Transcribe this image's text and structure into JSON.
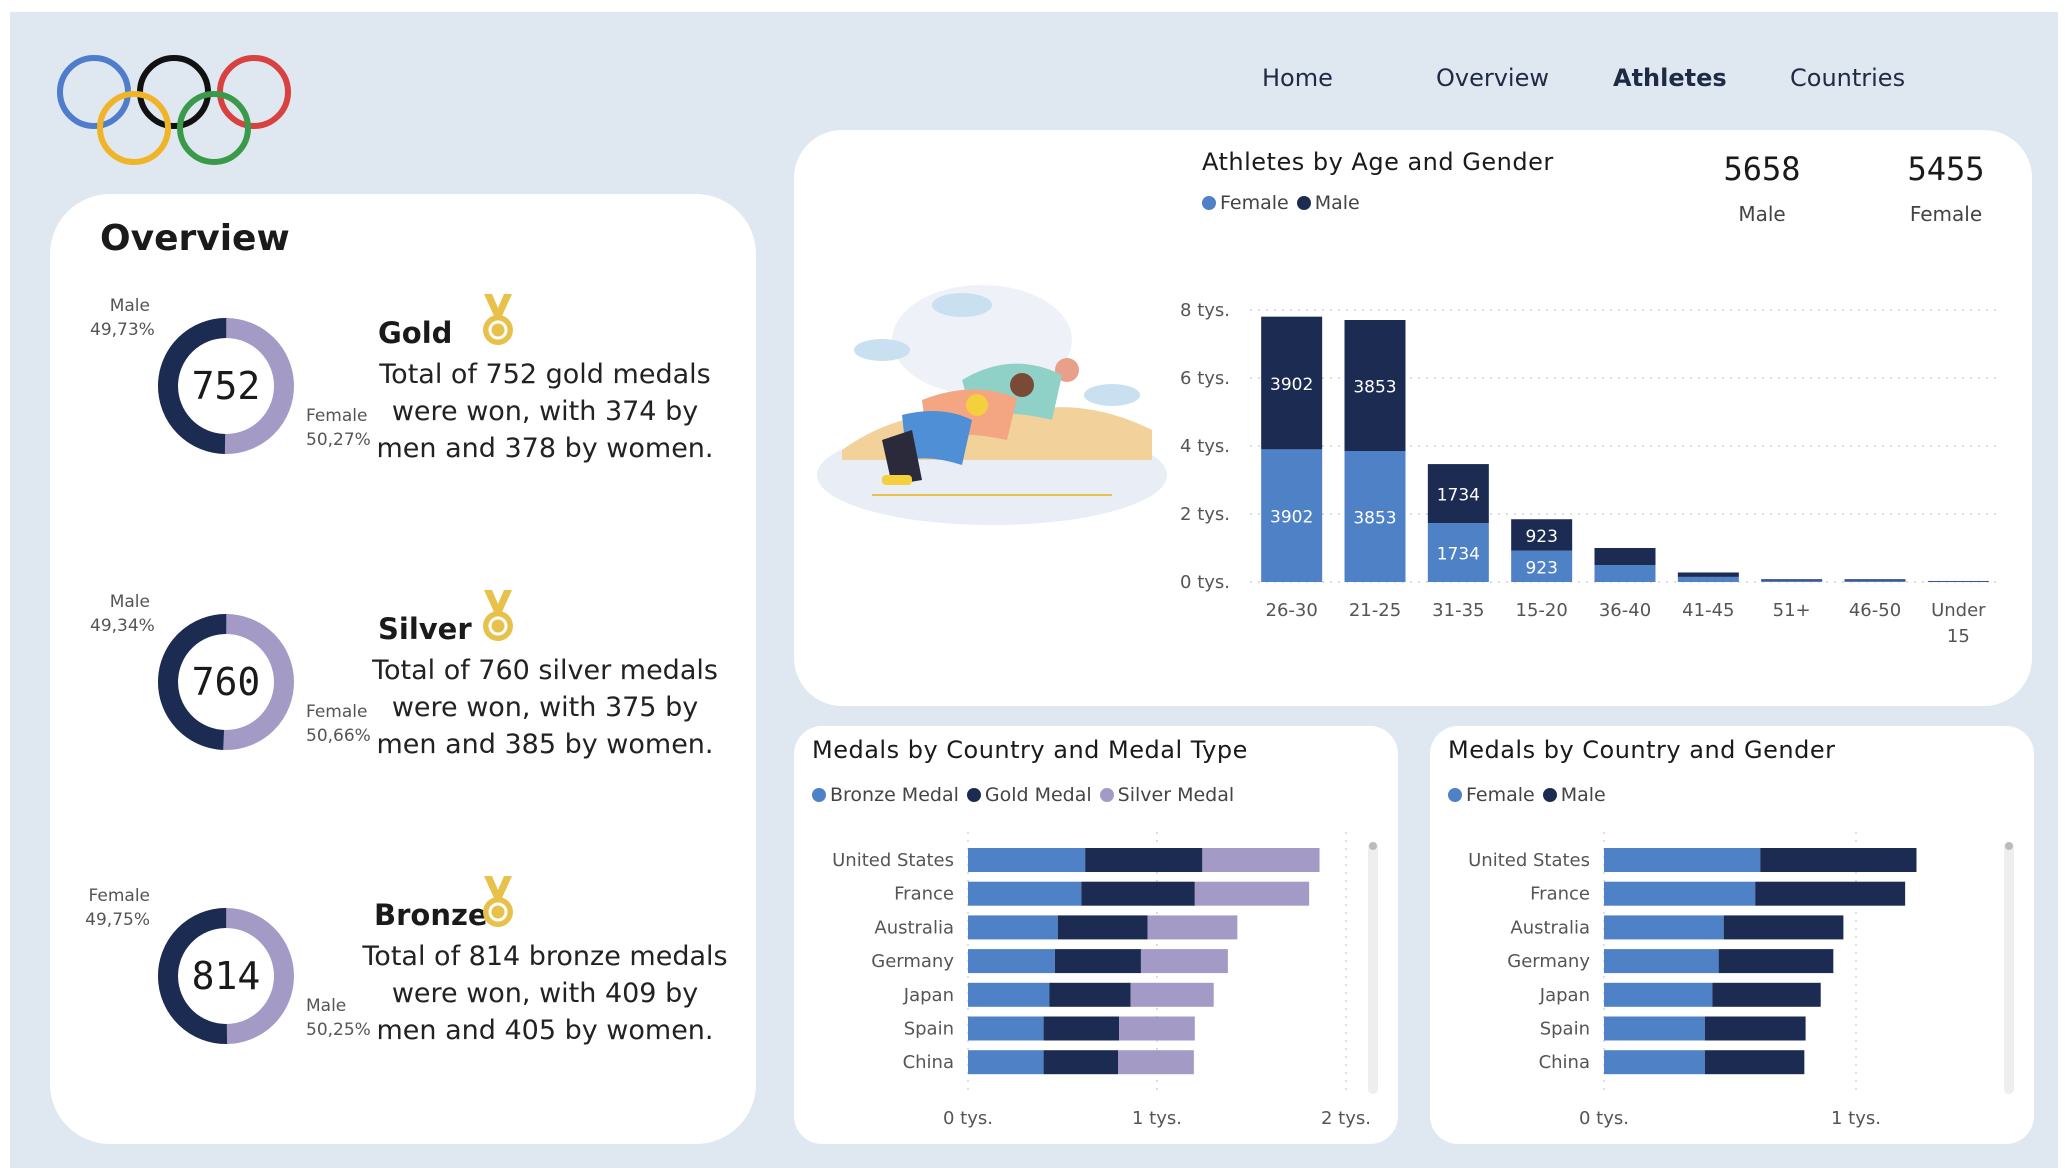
{
  "nav": {
    "items": [
      "Home",
      "Overview",
      "Athletes",
      "Countries"
    ],
    "active": "Athletes"
  },
  "overview": {
    "title": "Overview",
    "medals": [
      {
        "name": "Gold",
        "total": "752",
        "text": "Total of 752 gold medals were won, with 374 by men and 378 by women.",
        "label_top": "Male",
        "pct_top": "49,73%",
        "label_bottom": "Female",
        "pct_bottom": "50,27%",
        "male_share": 0.4973
      },
      {
        "name": "Silver",
        "total": "760",
        "text": "Total of 760 silver medals were won, with 375 by men and 385 by women.",
        "label_top": "Male",
        "pct_top": "49,34%",
        "label_bottom": "Female",
        "pct_bottom": "50,66%",
        "male_share": 0.4934
      },
      {
        "name": "Bronze",
        "total": "814",
        "text": "Total of 814 bronze medals were won, with 409 by men and 405 by women.",
        "label_top": "Female",
        "pct_top": "49,75%",
        "label_bottom": "Male",
        "pct_bottom": "50,25%",
        "male_share": 0.5025
      }
    ]
  },
  "athletes": {
    "title": "Athletes by Age and Gender",
    "legend": [
      "Female",
      "Male"
    ],
    "kpis": [
      {
        "value": "5658",
        "label": "Male"
      },
      {
        "value": "5455",
        "label": "Female"
      }
    ]
  },
  "medals_type": {
    "title": "Medals by Country and Medal Type",
    "legend": [
      "Bronze Medal",
      "Gold Medal",
      "Silver Medal"
    ]
  },
  "medals_gender": {
    "title": "Medals by Country and Gender",
    "legend": [
      "Female",
      "Male"
    ]
  },
  "colors": {
    "female": "#4f81c7",
    "male": "#1b2b52",
    "silver": "#a49ac6",
    "gold_icon": "#e8c14a",
    "grid": "#d0d4dc"
  },
  "chart_data": [
    {
      "type": "bar",
      "title": "Athletes by Age and Gender",
      "categories": [
        "26-30",
        "21-25",
        "31-35",
        "15-20",
        "36-40",
        "41-45",
        "51+",
        "46-50",
        "Under 15"
      ],
      "series": [
        {
          "name": "Female",
          "values": [
            3902,
            3853,
            1734,
            923,
            500,
            150,
            40,
            40,
            15
          ]
        },
        {
          "name": "Male",
          "values": [
            3902,
            3853,
            1734,
            923,
            500,
            130,
            40,
            40,
            15
          ]
        }
      ],
      "data_labels": [
        [
          "3902",
          "3853",
          "1734",
          "923",
          "",
          "",
          "",
          "",
          ""
        ],
        [
          "3902",
          "3853",
          "1734",
          "923",
          "",
          "",
          "",
          "",
          ""
        ]
      ],
      "stacked": true,
      "ylim": [
        0,
        8000
      ],
      "yticks": [
        0,
        2000,
        4000,
        6000,
        8000
      ],
      "ytick_labels": [
        "0 tys.",
        "2 tys.",
        "4 tys.",
        "6 tys.",
        "8 tys."
      ],
      "xtick_labels": [
        "26-30",
        "21-25",
        "31-35",
        "15-20",
        "36-40",
        "41-45",
        "51+",
        "46-50",
        "Under 15"
      ],
      "grid": true
    },
    {
      "type": "bar",
      "orientation": "horizontal",
      "title": "Medals by Country and Medal Type",
      "categories": [
        "United States",
        "France",
        "Australia",
        "Germany",
        "Japan",
        "Spain",
        "China"
      ],
      "series": [
        {
          "name": "Bronze Medal",
          "values": [
            620,
            600,
            475,
            460,
            430,
            400,
            400
          ]
        },
        {
          "name": "Gold Medal",
          "values": [
            620,
            600,
            475,
            455,
            430,
            400,
            395
          ]
        },
        {
          "name": "Silver Medal",
          "values": [
            620,
            605,
            475,
            460,
            440,
            400,
            400
          ]
        }
      ],
      "stacked": true,
      "xlim": [
        0,
        2000
      ],
      "xticks": [
        0,
        1000,
        2000
      ],
      "xtick_labels": [
        "0 tys.",
        "1 tys.",
        "2 tys."
      ],
      "grid": true
    },
    {
      "type": "bar",
      "orientation": "horizontal",
      "title": "Medals by Country and Gender",
      "categories": [
        "United States",
        "France",
        "Australia",
        "Germany",
        "Japan",
        "Spain",
        "China"
      ],
      "series": [
        {
          "name": "Female",
          "values": [
            620,
            600,
            475,
            455,
            430,
            400,
            400
          ]
        },
        {
          "name": "Male",
          "values": [
            620,
            595,
            475,
            455,
            430,
            400,
            395
          ]
        }
      ],
      "stacked": true,
      "xlim": [
        0,
        1500
      ],
      "xticks": [
        0,
        1000
      ],
      "xtick_labels": [
        "0 tys.",
        "1 tys."
      ],
      "grid": true
    }
  ]
}
